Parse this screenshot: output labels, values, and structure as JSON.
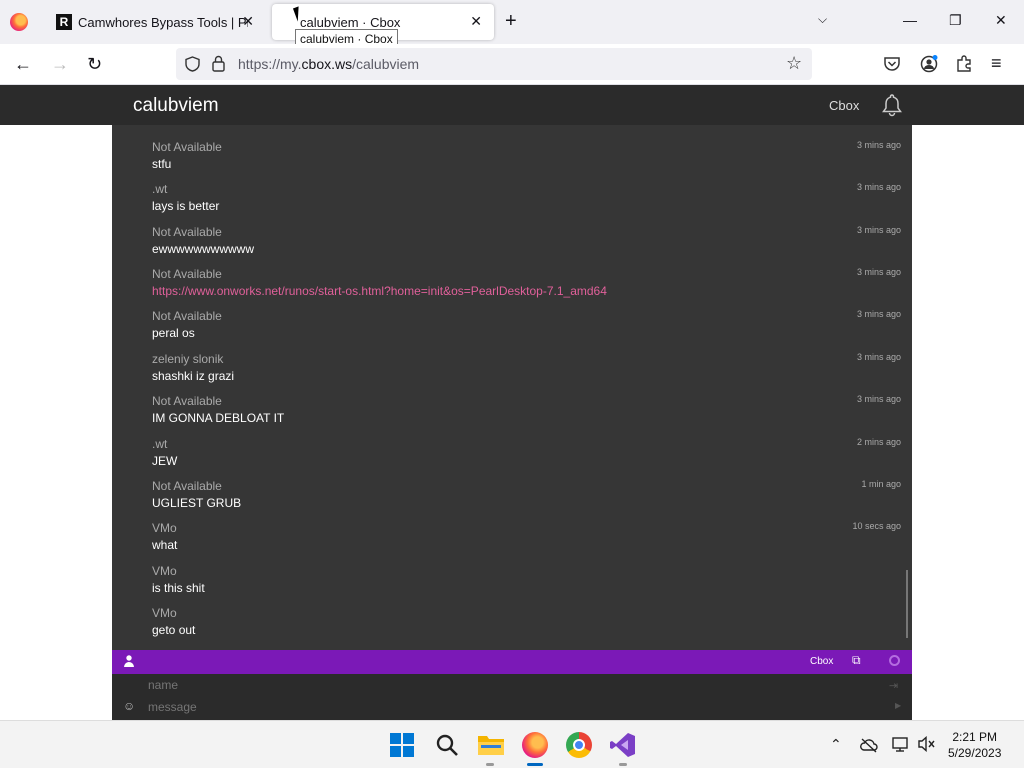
{
  "browser": {
    "tabs": [
      {
        "title": "Camwhores Bypass Tools | Priva",
        "favicon": "R",
        "active": false
      },
      {
        "title": "calubviem · Cbox",
        "active": true
      }
    ],
    "tooltip": "calubviem · Cbox",
    "url_prefix": "https://my.",
    "url_domain": "cbox.ws",
    "url_path": "/calubviem"
  },
  "cbox": {
    "title": "calubviem",
    "brand": "Cbox",
    "messages": [
      {
        "name": "Not Available",
        "body": "stfu",
        "time": "3 mins ago"
      },
      {
        "name": ".wt",
        "body": "lays is better",
        "time": "3 mins ago"
      },
      {
        "name": "Not Available",
        "body": "ewwwwwwwwwww",
        "time": "3 mins ago"
      },
      {
        "name": "Not Available",
        "body": "https://www.onworks.net/runos/start-os.html?home=init&os=PearlDesktop-7.1_amd64",
        "time": "3 mins ago",
        "link": true
      },
      {
        "name": "Not Available",
        "body": "peral os",
        "time": "3 mins ago"
      },
      {
        "name": "zeleniy slonik",
        "body": "shashki iz grazi",
        "time": "3 mins ago"
      },
      {
        "name": "Not Available",
        "body": "IM GONNA DEBLOAT IT",
        "time": "3 mins ago"
      },
      {
        "name": ".wt",
        "body": "JEW",
        "time": "2 mins ago"
      },
      {
        "name": "Not Available",
        "body": "UGLIEST GRUB",
        "time": "1 min ago"
      },
      {
        "name": "VMo",
        "body": "what",
        "time": "10 secs ago"
      },
      {
        "name": "VMo",
        "body": "is this shit",
        "time": ""
      },
      {
        "name": "VMo",
        "body": "geto out",
        "time": ""
      }
    ],
    "bar_label": "Cbox",
    "name_placeholder": "name",
    "message_placeholder": "message"
  },
  "taskbar": {
    "time": "2:21 PM",
    "date": "5/29/2023"
  }
}
